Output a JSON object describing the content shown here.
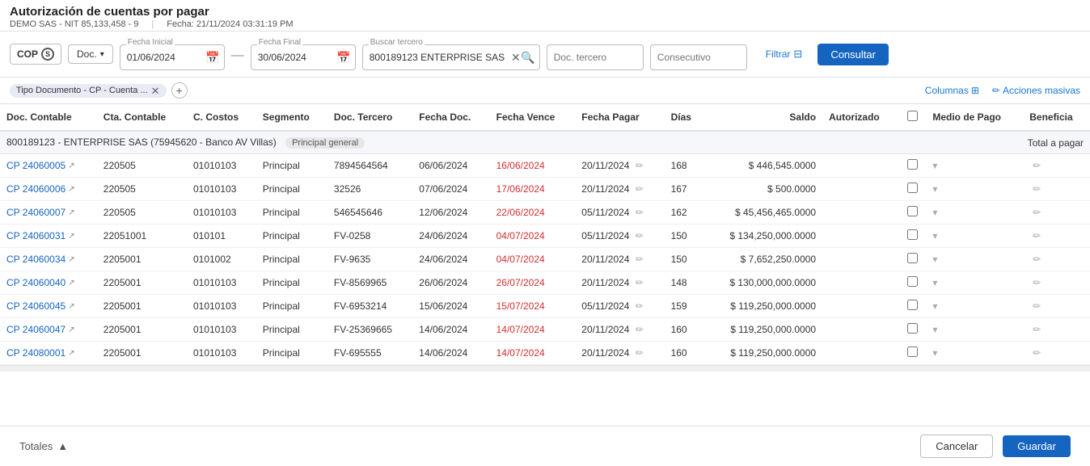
{
  "header": {
    "title": "Autorización de cuentas por pagar",
    "company": "DEMO SAS - NIT 85,133,458 - 9",
    "date_label": "Fecha: 21/11/2024 03:31:19 PM"
  },
  "toolbar": {
    "currency": "COP",
    "doc_label": "Doc.",
    "fecha_inicial_label": "Fecha Inicial",
    "fecha_inicial_value": "01/06/2024",
    "fecha_final_label": "Fecha Final",
    "fecha_final_value": "30/06/2024",
    "buscar_tercero_label": "Buscar tercero",
    "buscar_tercero_value": "800189123 ENTERPRISE SAS",
    "doc_tercero_placeholder": "Doc. tercero",
    "consecutivo_placeholder": "Consecutivo",
    "filtrar_label": "Filtrar",
    "consultar_label": "Consultar"
  },
  "chips": {
    "chip1": "Tipo Documento - CP - Cuenta ..."
  },
  "actions_bar": {
    "columns_label": "Columnas",
    "acciones_label": "Acciones masivas"
  },
  "table": {
    "headers": [
      "Doc. Contable",
      "Cta. Contable",
      "C. Costos",
      "Segmento",
      "Doc. Tercero",
      "Fecha Doc.",
      "Fecha Vence",
      "Fecha Pagar",
      "Días",
      "Saldo",
      "Autorizado",
      "",
      "Medio de Pago",
      "Beneficia"
    ],
    "group_label": "800189123 - ENTERPRISE SAS (75945620 - Banco AV Villas)",
    "principal_badge": "Principal general",
    "total_pagar_label": "Total a pagar",
    "rows": [
      {
        "doc": "CP 24060005",
        "cta": "220505",
        "costos": "01010103",
        "segmento": "Principal",
        "doc_tercero": "7894564564",
        "fecha_doc": "06/06/2024",
        "fecha_vence": "16/06/2024",
        "fecha_vence_red": true,
        "fecha_pagar": "20/11/2024",
        "dias": "168",
        "saldo": "$ 446,545.0000",
        "autorizado": false
      },
      {
        "doc": "CP 24060006",
        "cta": "220505",
        "costos": "01010103",
        "segmento": "Principal",
        "doc_tercero": "32526",
        "fecha_doc": "07/06/2024",
        "fecha_vence": "17/06/2024",
        "fecha_vence_red": true,
        "fecha_pagar": "20/11/2024",
        "dias": "167",
        "saldo": "$ 500.0000",
        "autorizado": false
      },
      {
        "doc": "CP 24060007",
        "cta": "220505",
        "costos": "01010103",
        "segmento": "Principal",
        "doc_tercero": "546545646",
        "fecha_doc": "12/06/2024",
        "fecha_vence": "22/06/2024",
        "fecha_vence_red": true,
        "fecha_pagar": "05/11/2024",
        "dias": "162",
        "saldo": "$ 45,456,465.0000",
        "autorizado": false
      },
      {
        "doc": "CP 24060031",
        "cta": "22051001",
        "costos": "010101",
        "segmento": "Principal",
        "doc_tercero": "FV-0258",
        "fecha_doc": "24/06/2024",
        "fecha_vence": "04/07/2024",
        "fecha_vence_red": true,
        "fecha_pagar": "05/11/2024",
        "dias": "150",
        "saldo": "$ 134,250,000.0000",
        "autorizado": false
      },
      {
        "doc": "CP 24060034",
        "cta": "2205001",
        "costos": "0101002",
        "segmento": "Principal",
        "doc_tercero": "FV-9635",
        "fecha_doc": "24/06/2024",
        "fecha_vence": "04/07/2024",
        "fecha_vence_red": true,
        "fecha_pagar": "20/11/2024",
        "dias": "150",
        "saldo": "$ 7,652,250.0000",
        "autorizado": false
      },
      {
        "doc": "CP 24060040",
        "cta": "2205001",
        "costos": "01010103",
        "segmento": "Principal",
        "doc_tercero": "FV-8569965",
        "fecha_doc": "26/06/2024",
        "fecha_vence": "26/07/2024",
        "fecha_vence_red": true,
        "fecha_pagar": "20/11/2024",
        "dias": "148",
        "saldo": "$ 130,000,000.0000",
        "autorizado": false
      },
      {
        "doc": "CP 24060045",
        "cta": "2205001",
        "costos": "01010103",
        "segmento": "Principal",
        "doc_tercero": "FV-6953214",
        "fecha_doc": "15/06/2024",
        "fecha_vence": "15/07/2024",
        "fecha_vence_red": true,
        "fecha_pagar": "05/11/2024",
        "dias": "159",
        "saldo": "$ 119,250,000.0000",
        "autorizado": false
      },
      {
        "doc": "CP 24060047",
        "cta": "2205001",
        "costos": "01010103",
        "segmento": "Principal",
        "doc_tercero": "FV-25369665",
        "fecha_doc": "14/06/2024",
        "fecha_vence": "14/07/2024",
        "fecha_vence_red": true,
        "fecha_pagar": "20/11/2024",
        "dias": "160",
        "saldo": "$ 119,250,000.0000",
        "autorizado": false
      },
      {
        "doc": "CP 24080001",
        "cta": "2205001",
        "costos": "01010103",
        "segmento": "Principal",
        "doc_tercero": "FV-695555",
        "fecha_doc": "14/06/2024",
        "fecha_vence": "14/07/2024",
        "fecha_vence_red": true,
        "fecha_pagar": "20/11/2024",
        "dias": "160",
        "saldo": "$ 119,250,000.0000",
        "autorizado": false
      }
    ]
  },
  "footer": {
    "totales_label": "Totales",
    "cancel_label": "Cancelar",
    "save_label": "Guardar"
  }
}
